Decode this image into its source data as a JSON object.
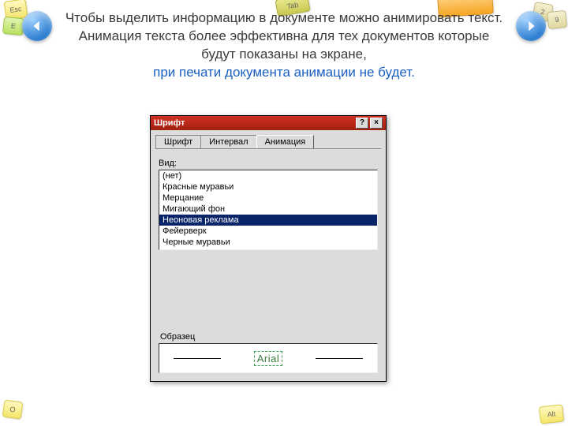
{
  "bgkeys": {
    "esc": "Esc",
    "e": "E",
    "tab": "Tab",
    "two": "2",
    "nine": "9",
    "alt": "Alt",
    "o": "O"
  },
  "headline": {
    "l1": "Чтобы выделить информацию в документе можно анимировать текст.",
    "l2": "Анимация текста более эффективна для тех документов которые будут показаны на экране,",
    "l3": "при печати документа анимации не будет."
  },
  "dialog": {
    "title": "Шрифт",
    "help_btn": "?",
    "close_btn": "×",
    "tabs": {
      "font": "Шрифт",
      "interval": "Интервал",
      "anim": "Анимация"
    },
    "kind_label": "Вид:",
    "options": [
      "(нет)",
      "Красные муравьи",
      "Мерцание",
      "Мигающий фон",
      "Неоновая реклама",
      "Фейерверк",
      "Черные муравьи"
    ],
    "selected_index": 4,
    "preview_label": "Образец",
    "preview_text": "Arial"
  }
}
